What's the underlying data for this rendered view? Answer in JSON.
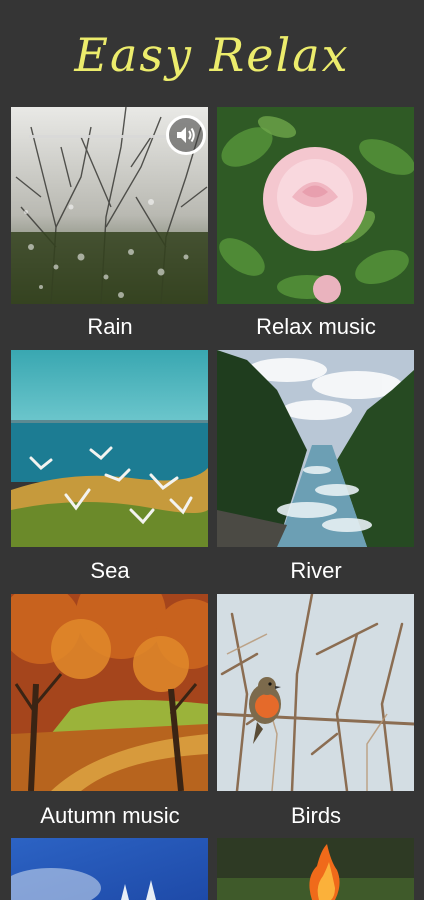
{
  "app": {
    "title": "Easy Relax"
  },
  "tiles": [
    {
      "label": "Rain",
      "image": "rain-window-photo",
      "playing": true,
      "volume_icon": "speaker-volume-icon"
    },
    {
      "label": "Relax music",
      "image": "pink-rose-photo"
    },
    {
      "label": "Sea",
      "image": "sea-seagulls-photo"
    },
    {
      "label": "River",
      "image": "mountain-river-photo"
    },
    {
      "label": "Autumn music",
      "image": "autumn-park-photo"
    },
    {
      "label": "Birds",
      "image": "robin-on-branch-photo"
    },
    {
      "label": "",
      "image": "winter-sky-photo"
    },
    {
      "label": "",
      "image": "campfire-photo"
    }
  ],
  "colors": {
    "background": "#353535",
    "title": "#ecec6c",
    "label": "#ffffff"
  }
}
